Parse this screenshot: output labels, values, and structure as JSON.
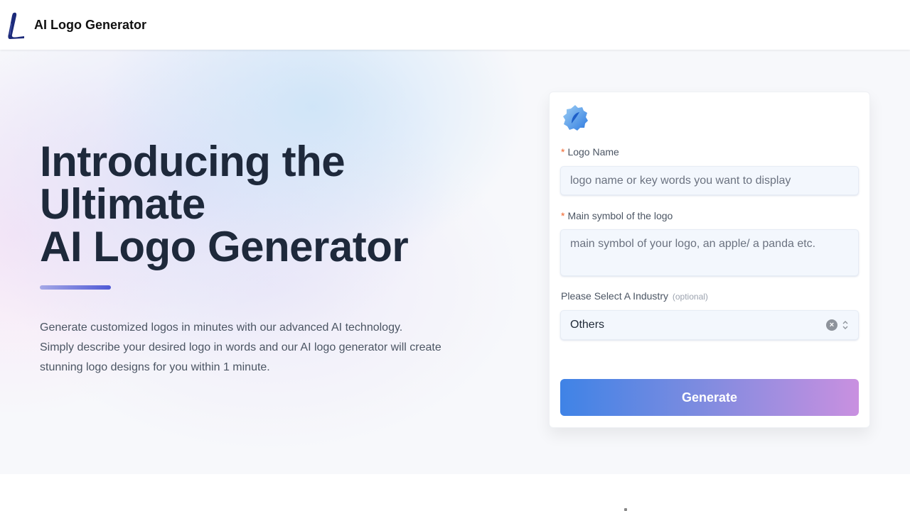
{
  "navbar": {
    "brand_name": "AI Logo Generator",
    "logo_icon": "script-l-logo-icon"
  },
  "hero": {
    "headline_lines": [
      "Introducing the",
      "Ultimate",
      "AI Logo Generator"
    ],
    "description_lines": [
      "Generate customized logos in minutes with our advanced AI technology.",
      "Simply describe your desired logo in words and our AI logo generator will create",
      "stunning logo designs for you within 1 minute."
    ]
  },
  "form": {
    "icon": "blue-badge-feather-icon",
    "logo_name": {
      "required_mark": "*",
      "label": "Logo Name",
      "value": "",
      "placeholder": "logo name or key words you want to display"
    },
    "main_symbol": {
      "required_mark": "*",
      "label": "Main symbol of the logo",
      "value": "",
      "placeholder": "main symbol of your logo, an apple/ a panda etc."
    },
    "industry": {
      "label": "Please Select A Industry",
      "optional_note": "(optional)",
      "selected": "Others",
      "clear_icon_glyph": "×"
    },
    "generate_label": "Generate"
  },
  "colors": {
    "heading": "#1e293b",
    "required": "#f0652c",
    "button_gradient_start": "#3f83e6",
    "button_gradient_end": "#c990e0"
  }
}
